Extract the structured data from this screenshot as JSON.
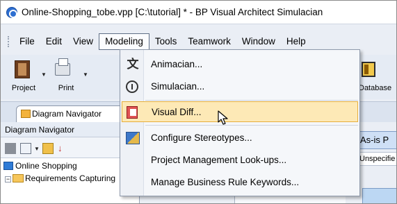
{
  "window": {
    "title": "Online-Shopping_tobe.vpp [C:\\tutorial] * - BP Visual Architect Simulacian"
  },
  "menubar": {
    "items": [
      "File",
      "Edit",
      "View",
      "Modeling",
      "Tools",
      "Teamwork",
      "Window",
      "Help"
    ],
    "active": "Modeling"
  },
  "toolbar": {
    "project_label": "Project",
    "print_label": "Print",
    "database_label": "Database"
  },
  "tabs": {
    "diagram_navigator": "Diagram Navigator"
  },
  "navigator": {
    "header": "Diagram Navigator",
    "tree": [
      {
        "label": "Online Shopping"
      },
      {
        "label": "Requirements Capturing"
      }
    ]
  },
  "right_peek": {
    "asis_tab": "As-is P",
    "unspecified": "Unspecifie"
  },
  "modeling_menu": {
    "items": [
      {
        "label": "Animacian...",
        "icon": "animacian-icon"
      },
      {
        "label": "Simulacian...",
        "icon": "simulacian-icon"
      },
      {
        "label": "Visual Diff...",
        "icon": "visual-diff-icon",
        "highlighted": true
      },
      {
        "label": "Configure Stereotypes...",
        "icon": "stereotypes-icon"
      },
      {
        "label": "Project Management Look-ups...",
        "icon": ""
      },
      {
        "label": "Manage Business Rule Keywords...",
        "icon": ""
      }
    ]
  },
  "colors": {
    "menu_highlight_bg": "#fde9b6",
    "menu_highlight_border": "#e6ae3b",
    "accent_blue": "#2e6fd1"
  }
}
